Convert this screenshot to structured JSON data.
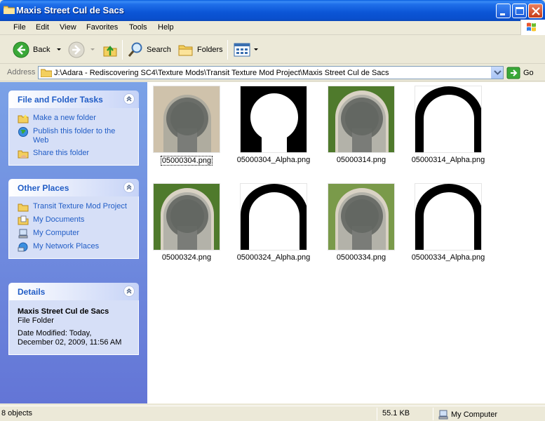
{
  "window": {
    "title": "Maxis Street Cul de Sacs",
    "colors": {
      "titlebar": "#0a4fcc",
      "taskpane": "#6375d6",
      "link": "#215dc6"
    }
  },
  "menu": [
    "File",
    "Edit",
    "View",
    "Favorites",
    "Tools",
    "Help"
  ],
  "toolbar": {
    "back_label": "Back",
    "search_label": "Search",
    "folders_label": "Folders"
  },
  "address": {
    "label": "Address",
    "path": "J:\\Adara - Rediscovering SC4\\Texture Mods\\Transit Texture Mod Project\\Maxis Street Cul de Sacs",
    "go_label": "Go"
  },
  "tasks_panel": {
    "title": "File and Folder Tasks",
    "items": [
      {
        "label": "Make a new folder",
        "icon": "new-folder-icon"
      },
      {
        "label": "Publish this folder to the Web",
        "icon": "globe-icon"
      },
      {
        "label": "Share this folder",
        "icon": "share-folder-icon"
      }
    ]
  },
  "places_panel": {
    "title": "Other Places",
    "items": [
      {
        "label": "Transit Texture Mod Project",
        "icon": "folder-icon"
      },
      {
        "label": "My Documents",
        "icon": "my-documents-icon"
      },
      {
        "label": "My Computer",
        "icon": "my-computer-icon"
      },
      {
        "label": "My Network Places",
        "icon": "network-places-icon"
      }
    ]
  },
  "details_panel": {
    "title": "Details",
    "name": "Maxis Street Cul de Sacs",
    "type": "File Folder",
    "modified_label": "Date Modified: Today,",
    "modified_date": "December 02, 2009, 11:56 AM"
  },
  "files": [
    {
      "name": "05000304.png",
      "kind": "texture",
      "style": "sand"
    },
    {
      "name": "05000304_Alpha.png",
      "kind": "alpha",
      "style": "cap"
    },
    {
      "name": "05000314.png",
      "kind": "texture",
      "style": "grass"
    },
    {
      "name": "05000314_Alpha.png",
      "kind": "alpha",
      "style": "arch"
    },
    {
      "name": "05000324.png",
      "kind": "texture",
      "style": "grass"
    },
    {
      "name": "05000324_Alpha.png",
      "kind": "alpha",
      "style": "arch"
    },
    {
      "name": "05000334.png",
      "kind": "texture",
      "style": "grass-pale"
    },
    {
      "name": "05000334_Alpha.png",
      "kind": "alpha",
      "style": "arch"
    }
  ],
  "status": {
    "objects": "8 objects",
    "size": "55.1 KB",
    "location": "My Computer"
  }
}
